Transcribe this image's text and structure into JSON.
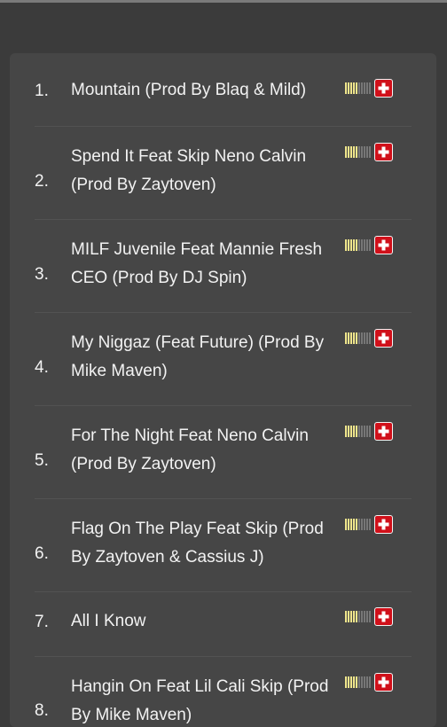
{
  "tracks": [
    {
      "number": "1.",
      "title": "Mountain (Prod By Blaq & Mild)",
      "rating": 0.5
    },
    {
      "number": "2.",
      "title": "Spend It Feat Skip Neno Calvin (Prod By Zaytoven)",
      "rating": 0.5
    },
    {
      "number": "3.",
      "title": "MILF Juvenile Feat Mannie Fresh CEO (Prod By DJ Spin)",
      "rating": 0.5
    },
    {
      "number": "4.",
      "title": "My Niggaz (Feat Future) (Prod By Mike Maven)",
      "rating": 0.5
    },
    {
      "number": "5.",
      "title": "For The Night Feat Neno Calvin (Prod By Zaytoven)",
      "rating": 0.5
    },
    {
      "number": "6.",
      "title": "Flag On The Play Feat Skip (Prod By Zaytoven & Cassius J)",
      "rating": 0.5
    },
    {
      "number": "7.",
      "title": "All I Know",
      "rating": 0.5
    },
    {
      "number": "8.",
      "title": "Hangin On Feat Lil Cali Skip (Prod By Mike Maven)",
      "rating": 0.5
    }
  ],
  "colors": {
    "background": "#3b3b3b",
    "panel": "#464646",
    "meter_on": "#f0e68c",
    "meter_off": "#777777",
    "add_button": "#d0101a"
  },
  "icons": {
    "rating": "rating-meter-icon",
    "add": "add-plus-icon"
  }
}
